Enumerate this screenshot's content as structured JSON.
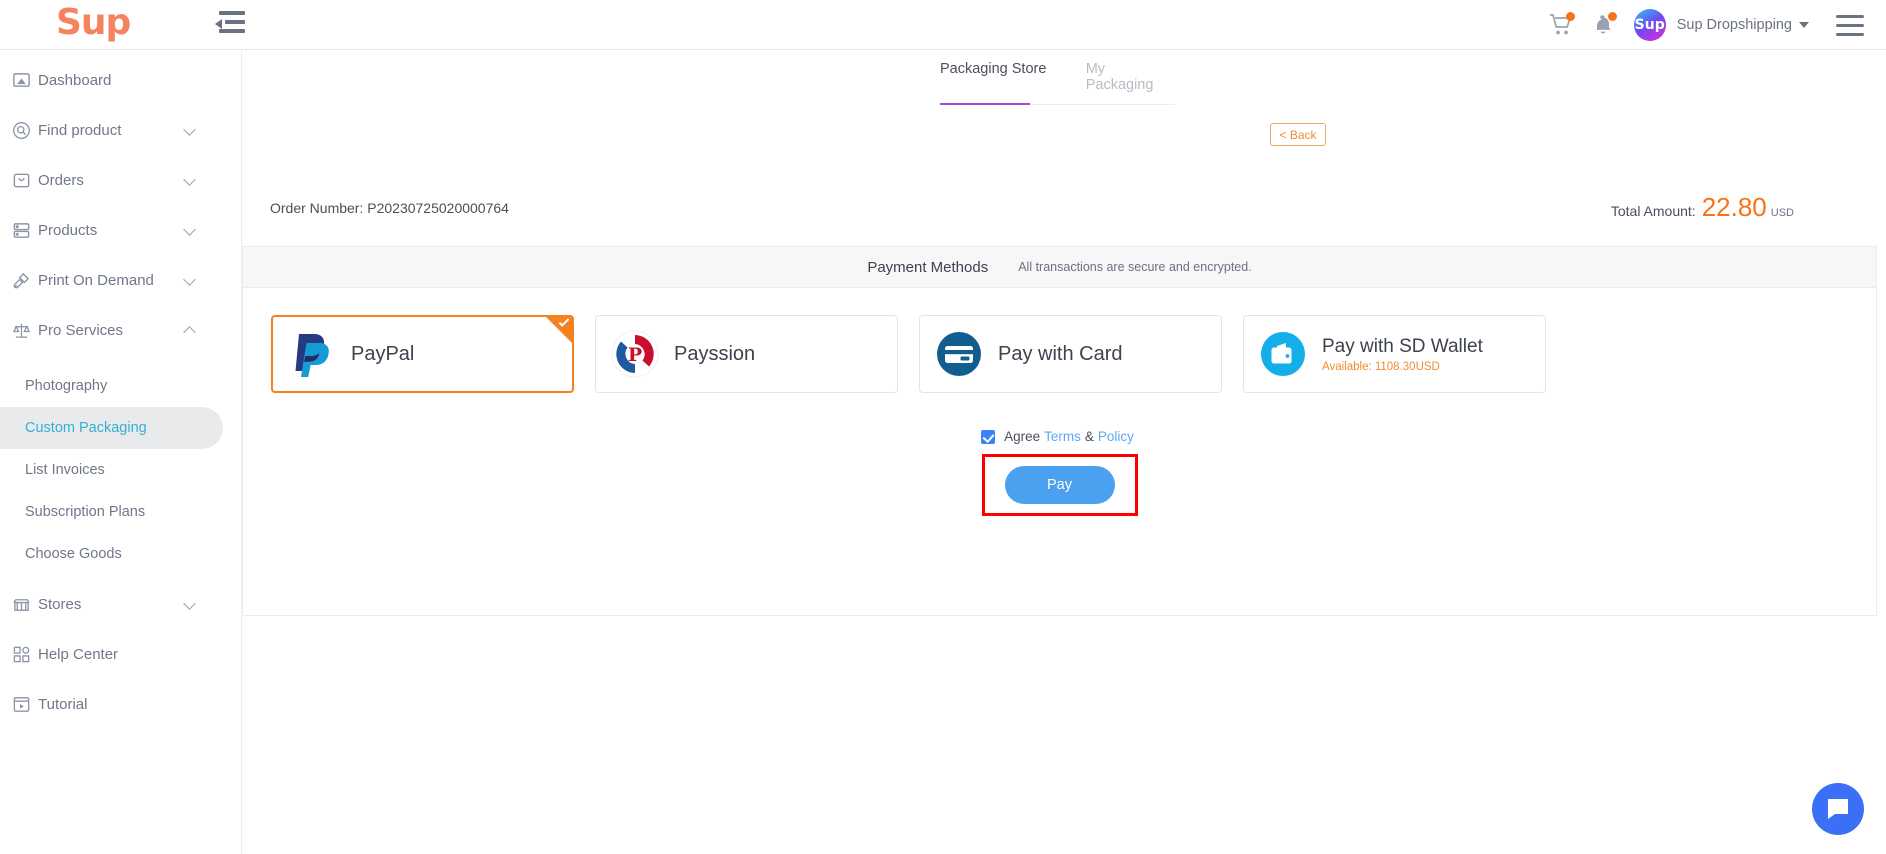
{
  "header": {
    "brand": "Sup",
    "collapse_icon": "collapse-menu-icon",
    "cart_icon": "cart-icon",
    "bell_icon": "bell-icon",
    "avatar_text": "Sup",
    "username": "Sup Dropshipping",
    "menu_icon": "hamburger-icon"
  },
  "sidebar": {
    "items": [
      {
        "label": "Dashboard",
        "icon": "dashboard-icon",
        "expandable": false
      },
      {
        "label": "Find product",
        "icon": "search-circle-icon",
        "expandable": true,
        "expanded": false
      },
      {
        "label": "Orders",
        "icon": "bag-icon",
        "expandable": true,
        "expanded": false
      },
      {
        "label": "Products",
        "icon": "server-icon",
        "expandable": true,
        "expanded": false
      },
      {
        "label": "Print On Demand",
        "icon": "design-tools-icon",
        "expandable": true,
        "expanded": false
      },
      {
        "label": "Pro Services",
        "icon": "scales-icon",
        "expandable": true,
        "expanded": true
      }
    ],
    "sub_items": [
      {
        "label": "Photography",
        "active": false
      },
      {
        "label": "Custom Packaging",
        "active": true
      },
      {
        "label": "List Invoices",
        "active": false
      },
      {
        "label": "Subscription Plans",
        "active": false
      },
      {
        "label": "Choose Goods",
        "active": false
      }
    ],
    "bottom_items": [
      {
        "label": "Stores",
        "icon": "store-icon",
        "expandable": true
      },
      {
        "label": "Help Center",
        "icon": "grid-help-icon",
        "expandable": false
      },
      {
        "label": "Tutorial",
        "icon": "video-icon",
        "expandable": false
      }
    ],
    "active_color": "#35b0d3"
  },
  "main": {
    "tabs": [
      {
        "label": "Packaging Store",
        "active": true
      },
      {
        "label": "My Packaging",
        "active": false
      }
    ],
    "tab_underline_color": "#9d4edd",
    "back_button": "< Back",
    "order_number_label": "Order Number:",
    "order_number_value": "P20230725020000764",
    "total_label": "Total Amount:",
    "total_value": "22.80",
    "total_currency": "USD",
    "total_color": "#f97316"
  },
  "payment": {
    "title": "Payment Methods",
    "subtitle": "All transactions are secure and encrypted.",
    "methods": [
      {
        "name": "PayPal",
        "logo": "paypal-logo-icon",
        "selected": true,
        "available": null
      },
      {
        "name": "Payssion",
        "logo": "payssion-logo-icon",
        "selected": false,
        "available": null
      },
      {
        "name": "Pay with Card",
        "logo": "credit-card-icon",
        "selected": false,
        "available": null
      },
      {
        "name": "Pay with SD Wallet",
        "logo": "wallet-icon",
        "selected": false,
        "available": "Available: 1108.30USD"
      }
    ],
    "agree_label": "Agree",
    "terms_link": "Terms",
    "amp": "&",
    "policy_link": "Policy",
    "agree_checked": true,
    "pay_button": "Pay",
    "highlight_color": "#ff0000"
  },
  "chat": {
    "icon": "chat-bubble-icon"
  }
}
